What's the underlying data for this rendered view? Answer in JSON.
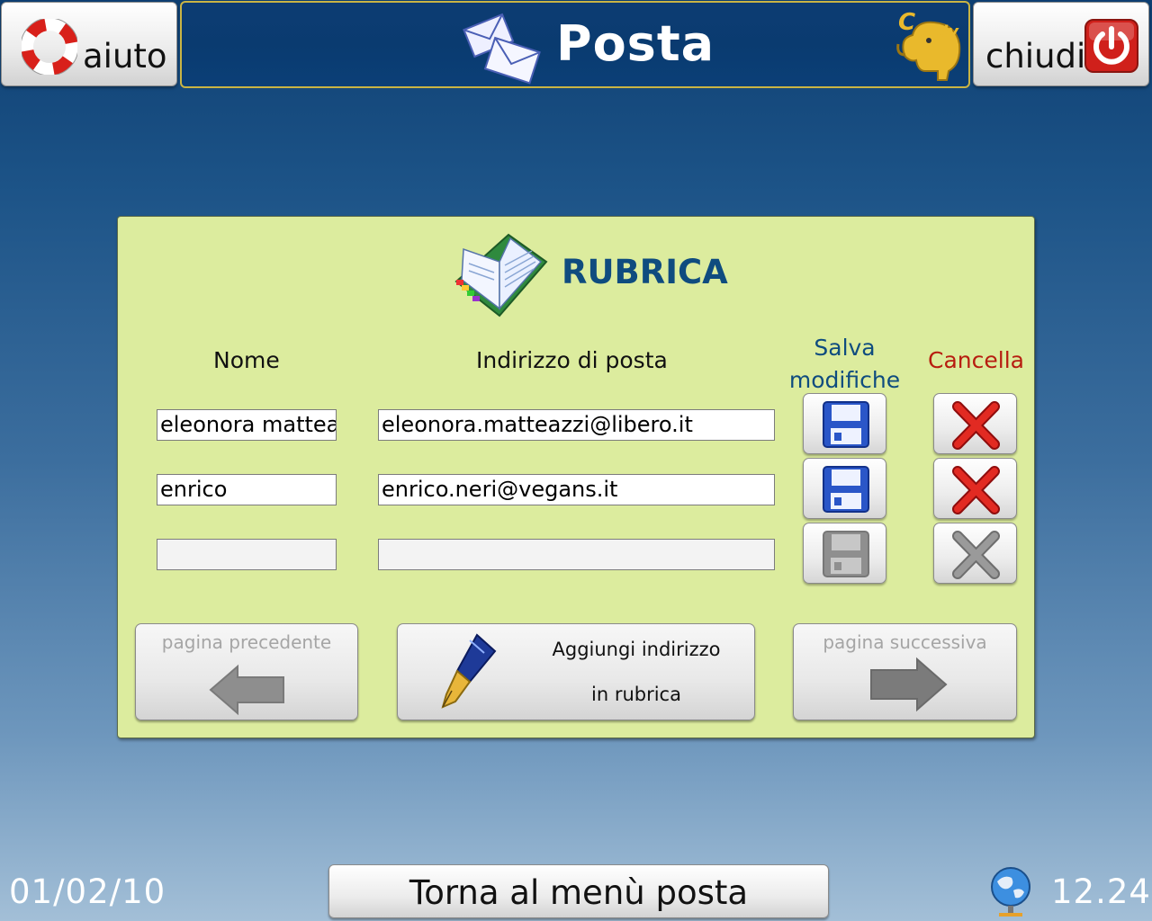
{
  "header": {
    "help_label": "aiuto",
    "title": "Posta",
    "close_label": "chiudi",
    "logo_text": "eldy"
  },
  "rubrica": {
    "title": "RUBRICA",
    "columns": {
      "name": "Nome",
      "email": "Indirizzo di posta",
      "save_line1": "Salva",
      "save_line2": "modifiche",
      "delete": "Cancella"
    },
    "rows": [
      {
        "name": "eleonora matteazzi",
        "email": "eleonora.matteazzi@libero.it",
        "enabled": true
      },
      {
        "name": "enrico",
        "email": "enrico.neri@vegans.it",
        "enabled": true
      },
      {
        "name": "",
        "email": "",
        "enabled": false
      }
    ],
    "prev_page_label": "pagina precedente",
    "next_page_label": "pagina successiva",
    "add_line1": "Aggiungi indirizzo",
    "add_line2": "in rubrica"
  },
  "footer": {
    "date": "01/02/10",
    "back_label": "Torna al menù posta",
    "time": "12.24"
  },
  "colors": {
    "title_bar": "#0d3c73",
    "panel": "#dcec9e",
    "accent_blue": "#0f4c7f",
    "delete_red": "#b71d10"
  },
  "icons": [
    "lifebuoy-icon",
    "envelopes-icon",
    "eldy-elephant-logo",
    "power-icon",
    "address-book-icon",
    "floppy-disk-icon",
    "delete-x-icon",
    "arrow-left-icon",
    "fountain-pen-icon",
    "arrow-right-icon",
    "network-globe-icon"
  ]
}
